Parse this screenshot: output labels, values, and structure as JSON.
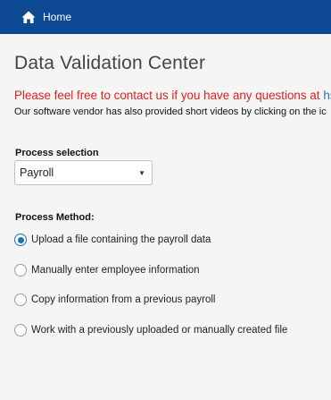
{
  "nav": {
    "home_label": "Home"
  },
  "page": {
    "title": "Data Validation Center",
    "contact_text": "Please feel free to contact us if you have any questions at",
    "contact_link": "hsav",
    "vendor_text": "Our software vendor has also provided short videos by clicking on the ic"
  },
  "process_selection": {
    "label": "Process selection",
    "selected": "Payroll"
  },
  "process_method": {
    "label": "Process Method:",
    "options": [
      {
        "label": "Upload a file containing the payroll data",
        "checked": true
      },
      {
        "label": "Manually enter employee information",
        "checked": false
      },
      {
        "label": "Copy information from a previous payroll",
        "checked": false
      },
      {
        "label": "Work with a previously uploaded or manually created file",
        "checked": false
      }
    ]
  },
  "colors": {
    "topbar": "#0e4a94",
    "contact_red": "#e0201c",
    "link_blue": "#2a6da8",
    "radio_accent": "#1f6fb7"
  }
}
